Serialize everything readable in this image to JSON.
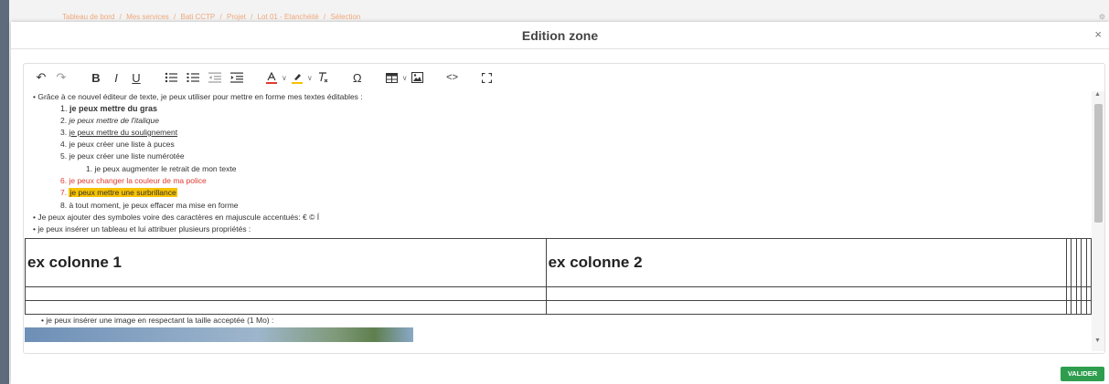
{
  "breadcrumb": [
    "Tableau de bord",
    "/",
    "Mes services",
    "/",
    "Bati CCTP",
    "/",
    "Projet",
    "/",
    "Lot 01 - Etanchéité",
    "/",
    "Sélection"
  ],
  "modal": {
    "title": "Edition zone",
    "close": "×"
  },
  "toolbar": {
    "undo": "↶",
    "redo": "↷",
    "bold": "B",
    "italic": "I",
    "underline": "U",
    "special_char": "Ω",
    "code": "<>",
    "chevron": "∨"
  },
  "content": {
    "intro": "Grâce à ce nouvel éditeur de texte, je peux utiliser pour mettre en forme mes textes éditables :",
    "items": [
      "je peux mettre du gras",
      "je peux mettre de l'italique",
      "je peux mettre du soulignement",
      "je peux créer une liste à puces",
      "je peux créer une liste numérotée",
      "je peux augmenter le retrait de mon texte",
      "je peux changer la couleur de ma police",
      "je peux mettre une surbrillance",
      "à tout moment, je peux effacer ma mise en forme"
    ],
    "nums": [
      "1.",
      "2.",
      "3.",
      "4.",
      "5.",
      "1.",
      "6.",
      "7.",
      "8."
    ],
    "symbols": "Je peux ajouter des symboles voire des caractères en majuscule accentués: € © Í",
    "table_intro": "je peux insérer un tableau et lui attribuer plusieurs propriétés :",
    "table_headers": [
      "ex colonne 1",
      "ex colonne 2"
    ],
    "image_intro": "je peux insérer une image en respectant la taille acceptée (1 Mo) :",
    "bullet": "•"
  },
  "actions": {
    "validate": "VALIDER"
  },
  "colors": {
    "accent": "#2e9e4e",
    "red_text": "#e03a2f",
    "highlight": "#f7c200",
    "breadcrumb": "#f0a87a"
  }
}
